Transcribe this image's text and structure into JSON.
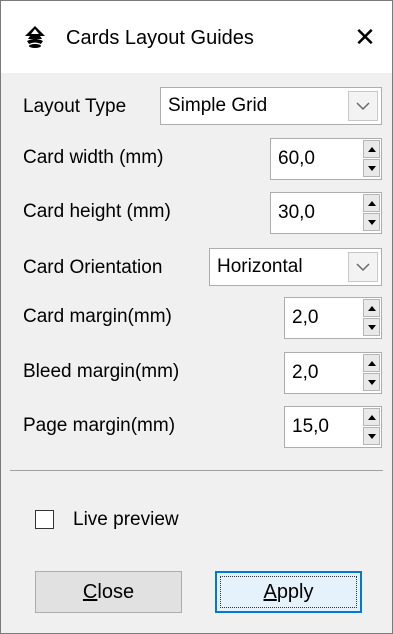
{
  "window": {
    "title": "Cards Layout Guides",
    "app_icon": "inkscape-logo-icon",
    "close_glyph": "✕"
  },
  "form": {
    "layout_type": {
      "label": "Layout Type",
      "value": "Simple Grid"
    },
    "card_width": {
      "label": "Card width (mm)",
      "value": "60,0"
    },
    "card_height": {
      "label": "Card height (mm)",
      "value": "30,0"
    },
    "card_orientation": {
      "label": "Card Orientation",
      "value": "Horizontal"
    },
    "card_margin": {
      "label": "Card margin(mm)",
      "value": "2,0"
    },
    "bleed_margin": {
      "label": "Bleed margin(mm)",
      "value": "2,0"
    },
    "page_margin": {
      "label": "Page margin(mm)",
      "value": "15,0"
    }
  },
  "live_preview": {
    "label": "Live preview",
    "checked": false
  },
  "buttons": {
    "close": {
      "mnemonic": "C",
      "rest": "lose"
    },
    "apply": {
      "mnemonic": "A",
      "rest": "pply"
    }
  },
  "colors": {
    "focus_border": "#0078d7",
    "window_bg": "#f0f0f0"
  }
}
